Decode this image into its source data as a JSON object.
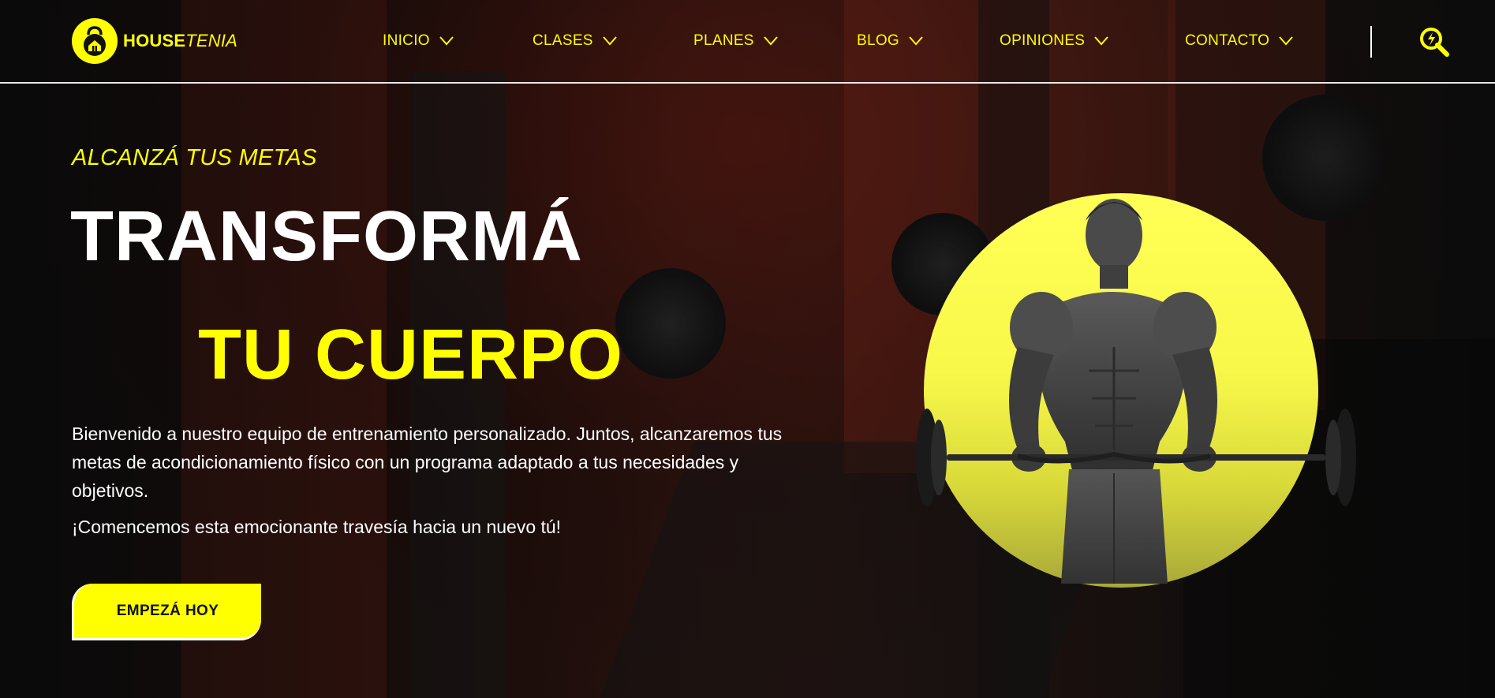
{
  "brand": {
    "name_bold": "HOUSE",
    "name_italic": "TENIA",
    "accent_color": "#ffff00",
    "logo_icon": "kettlebell-house-icon"
  },
  "nav": {
    "items": [
      {
        "label": "INICIO"
      },
      {
        "label": "CLASES"
      },
      {
        "label": "PLANES"
      },
      {
        "label": "BLOG"
      },
      {
        "label": "OPINIONES"
      },
      {
        "label": "CONTACTO"
      }
    ],
    "chevron_icon": "chevron-down-icon",
    "search_icon": "search-icon"
  },
  "hero": {
    "eyebrow": "ALCANZÁ TUS METAS",
    "headline_line1": "TRANSFORMÁ",
    "headline_line2": "TU CUERPO",
    "description": "Bienvenido a nuestro equipo de entrenamiento personalizado. Juntos, alcanzaremos tus metas de acondicionamiento físico con un programa adaptado a tus necesidades y objetivos.",
    "tagline": "¡Comencemos esta emocionante travesía hacia un nuevo tú!",
    "cta_label": "EMPEZÁ HOY",
    "image": "athlete-barbell-curl-image"
  }
}
